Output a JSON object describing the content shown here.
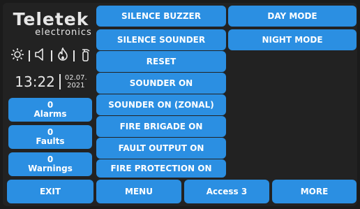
{
  "brand": {
    "name": "Teletek",
    "sub": "electronics"
  },
  "status_icons": [
    "sun-icon",
    "speaker-icon",
    "flame-icon",
    "fire-extinguisher-icon"
  ],
  "clock": {
    "time": "13:22",
    "date_line1": "02.07.",
    "date_line2": "2021"
  },
  "counters": [
    {
      "value": "0",
      "label": "Alarms"
    },
    {
      "value": "0",
      "label": "Faults"
    },
    {
      "value": "0",
      "label": "Warnings"
    }
  ],
  "actions": [
    "SILENCE BUZZER",
    "SILENCE SOUNDER",
    "RESET",
    "SOUNDER ON",
    "SOUNDER ON (ZONAL)",
    "FIRE BRIGADE ON",
    "FAULT OUTPUT ON",
    "FIRE PROTECTION ON"
  ],
  "modes": [
    "DAY MODE",
    "NIGHT MODE"
  ],
  "footer": {
    "exit": "EXIT",
    "menu": "MENU",
    "access": "Access 3",
    "more": "MORE"
  },
  "colors": {
    "button": "#2b8fe2",
    "background": "#222222",
    "text": "#ffffff"
  }
}
